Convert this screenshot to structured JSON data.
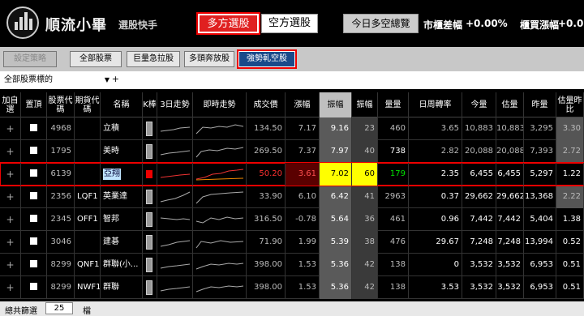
{
  "header": {
    "title": "順流小畢",
    "subtitle": "選股快手",
    "long_button": "多方選股",
    "short_button": "空方選股",
    "overview_button": "今日多空總覽",
    "otc_spread_label": "市櫃差幅",
    "otc_spread_value": "+0.00%",
    "otc_buy_label": "櫃買漲幅",
    "otc_buy_value": "+0.0"
  },
  "toolbar": {
    "set_strategy": "設定策略",
    "all_stocks": "全部股票",
    "big_volume": "巨量急拉股",
    "bull_run": "多頭奔放股",
    "strong_short_squeeze": "強勢軋空股"
  },
  "filter": {
    "selected": "全部股票標的"
  },
  "columns": [
    "加自選",
    "置頂",
    "股票代碼",
    "期貨代碼",
    "名稱",
    "K棒",
    "3日走勢",
    "即時走勢",
    "成交價",
    "漲幅",
    "振幅",
    "振幅",
    "量量",
    "日周轉率",
    "今量",
    "估量",
    "昨量",
    "估量昨比"
  ],
  "rows": [
    {
      "code": "4968",
      "fut": "",
      "name": "立積",
      "price": "134.50",
      "chg": "7.17",
      "amp": "9.16",
      "amp2": "23",
      "vol": "460",
      "turn": "3.65",
      "today": "10,883",
      "est": "10,883",
      "yest": "3,295",
      "ratio": "3.30"
    },
    {
      "code": "1795",
      "fut": "",
      "name": "美時",
      "price": "269.50",
      "chg": "7.37",
      "amp": "7.97",
      "amp2": "40",
      "vol": "738",
      "turn": "2.82",
      "today": "20,088",
      "est": "20,088",
      "yest": "7,393",
      "ratio": "2.72"
    },
    {
      "code": "6139",
      "fut": "",
      "name": "亞翔",
      "price": "50.20",
      "chg": "3.61",
      "amp": "7.02",
      "amp2": "60",
      "vol": "179",
      "turn": "2.35",
      "today": "6,455",
      "est": "6,455",
      "yest": "5,297",
      "ratio": "1.22"
    },
    {
      "code": "2356",
      "fut": "LQF1",
      "name": "英業達",
      "price": "33.90",
      "chg": "6.10",
      "amp": "6.42",
      "amp2": "41",
      "vol": "2963",
      "turn": "0.37",
      "today": "29,662",
      "est": "29,662",
      "yest": "13,368",
      "ratio": "2.22"
    },
    {
      "code": "2345",
      "fut": "OFF1",
      "name": "智邦",
      "price": "316.50",
      "chg": "-0.78",
      "amp": "5.64",
      "amp2": "36",
      "vol": "461",
      "turn": "0.96",
      "today": "7,442",
      "est": "7,442",
      "yest": "5,404",
      "ratio": "1.38"
    },
    {
      "code": "3046",
      "fut": "",
      "name": "建碁",
      "price": "71.90",
      "chg": "1.99",
      "amp": "5.39",
      "amp2": "38",
      "vol": "476",
      "turn": "29.67",
      "today": "7,248",
      "est": "7,248",
      "yest": "13,994",
      "ratio": "0.52"
    },
    {
      "code": "8299",
      "fut": "QNF1",
      "name": "群聯(小...",
      "price": "398.00",
      "chg": "1.53",
      "amp": "5.36",
      "amp2": "42",
      "vol": "138",
      "turn": "0",
      "today": "3,532",
      "est": "3,532",
      "yest": "6,953",
      "ratio": "0.51"
    },
    {
      "code": "8299",
      "fut": "NWF1",
      "name": "群聯",
      "price": "398.00",
      "chg": "1.53",
      "amp": "5.36",
      "amp2": "42",
      "vol": "138",
      "turn": "3.53",
      "today": "3,532",
      "est": "3,532",
      "yest": "6,953",
      "ratio": "0.51"
    }
  ],
  "footer": {
    "label": "總共篩選",
    "count": "25",
    "unit": "檔"
  },
  "colors": {
    "selected_row_outline": "#e00000",
    "highlight_yellow": "#ffff00",
    "up_red": "#ff3030",
    "up_green": "#00e000",
    "active_tab_blue": "#1a4a8a"
  }
}
